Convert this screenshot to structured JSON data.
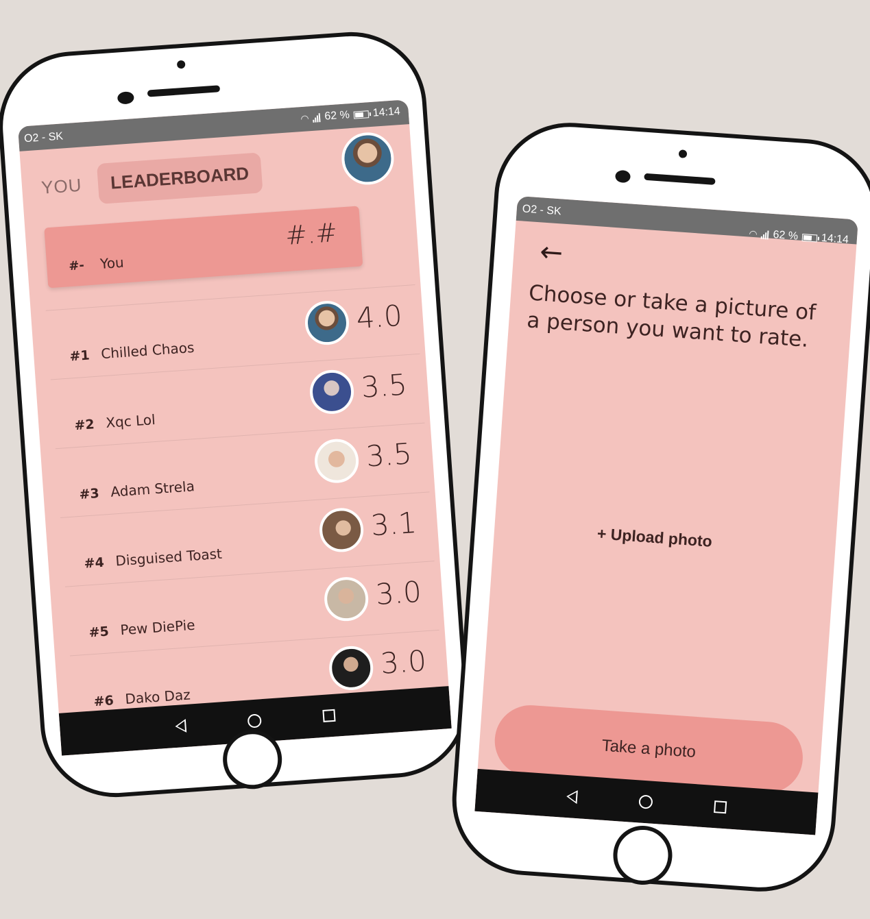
{
  "status": {
    "carrier": "O2 - SK",
    "battery_percent": "62 %",
    "time": "14:14"
  },
  "leaderboard": {
    "tab_you": "YOU",
    "tab_leaderboard": "LEADERBOARD",
    "you": {
      "rank": "#-",
      "name": "You",
      "score": "#.#"
    },
    "entries": [
      {
        "rank": "#1",
        "name": "Chilled Chaos",
        "score": "4.0"
      },
      {
        "rank": "#2",
        "name": "Xqc Lol",
        "score": "3.5"
      },
      {
        "rank": "#3",
        "name": "Adam Strela",
        "score": "3.5"
      },
      {
        "rank": "#4",
        "name": "Disguised Toast",
        "score": "3.1"
      },
      {
        "rank": "#5",
        "name": "Pew DiePie",
        "score": "3.0"
      },
      {
        "rank": "#6",
        "name": "Dako Daz",
        "score": "3.0"
      }
    ]
  },
  "rate": {
    "prompt": "Choose or take a picture of a person you want to rate.",
    "upload_label": "+ Upload photo",
    "take_photo_label": "Take a photo"
  },
  "icons": {
    "back": "arrow-left-icon",
    "wifi": "wifi-icon",
    "signal": "signal-icon",
    "battery": "battery-icon",
    "nav_back": "triangle-back-icon",
    "nav_home": "circle-home-icon",
    "nav_recent": "square-recent-icon"
  },
  "colors": {
    "background": "#e2dcd7",
    "screen": "#f4c3be",
    "accent": "#ed9893",
    "statusbar": "#6f6f6f",
    "text": "#3d2322"
  }
}
